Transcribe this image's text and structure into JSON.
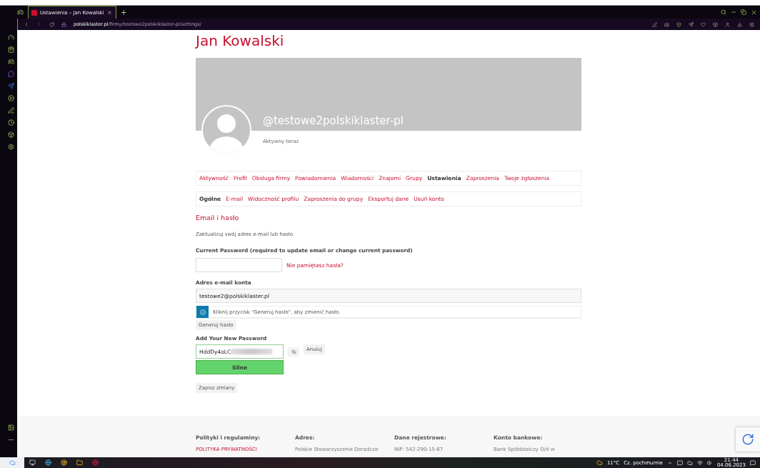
{
  "browser": {
    "tabs": [
      {
        "title": "Ustawienia – Jan Kowalski",
        "selected": true
      }
    ],
    "new_tab": "+",
    "url_domain": "polskiklaster.pl",
    "url_path": "/firmy/testowe2polskiklaster-pl/settings/"
  },
  "profile": {
    "name": "Jan Kowalski",
    "handle": "@testowe2polskiklaster-pl",
    "status": "Aktywny teraz"
  },
  "nav": [
    {
      "label": "Aktywność",
      "selected": false
    },
    {
      "label": "Profil",
      "selected": false
    },
    {
      "label": "Obsługa firmy",
      "selected": false
    },
    {
      "label": "Powiadomienia",
      "selected": false
    },
    {
      "label": "Wiadomości",
      "selected": false
    },
    {
      "label": "Znajomi",
      "selected": false
    },
    {
      "label": "Grupy",
      "selected": false
    },
    {
      "label": "Ustawienia",
      "selected": true
    },
    {
      "label": "Zaproszenia",
      "selected": false
    },
    {
      "label": "Twoje zgłoszenia",
      "selected": false
    }
  ],
  "subnav": [
    {
      "label": "Ogólne",
      "selected": true
    },
    {
      "label": "E-mail",
      "selected": false
    },
    {
      "label": "Widoczność profilu",
      "selected": false
    },
    {
      "label": "Zaproszenia do grupy",
      "selected": false
    },
    {
      "label": "Eksportuj dane",
      "selected": false
    },
    {
      "label": "Usuń konto",
      "selected": false
    }
  ],
  "form": {
    "heading": "Email i hasło",
    "intro": "Zaktualizuj swój adres e-mail lub hasło.",
    "current_password_label": "Current Password (required to update email or change current password)",
    "forgot_link": "Nie pamiętasz hasła?",
    "email_label": "Adres e-mail konta",
    "email_value": "testowe2@polskiklaster.pl",
    "info": "Kliknij przycisk \"Generuj hasło\", aby zmienić hasło.",
    "generate_button": "Generuj hasło",
    "new_password_label": "Add Your New Password",
    "new_password_value": "HddDy4oLC",
    "cancel_button": "Anuluj",
    "strength": {
      "label": "Silne",
      "level": 1
    },
    "save_button": "Zapisz zmiany"
  },
  "footer": {
    "columns": [
      {
        "heading": "Polityki i regulaminy:",
        "line": "POLITYKA PRYWATNOŚCI",
        "kind": "link"
      },
      {
        "heading": "Adres:",
        "line": "Polskie Stowarzyszenie Doradcze",
        "kind": "text"
      },
      {
        "heading": "Dane rejestrowe:",
        "line": "NIP: 542-290-15-67",
        "kind": "text"
      },
      {
        "heading": "Konto bankowe:",
        "line": "Bank Spółdzielczy O/d w",
        "kind": "text"
      }
    ]
  },
  "taskbar": {
    "weather": "11°C",
    "weather_text": "Cz. pochmurnie",
    "time": "21:44",
    "date": "04.06.2023"
  }
}
